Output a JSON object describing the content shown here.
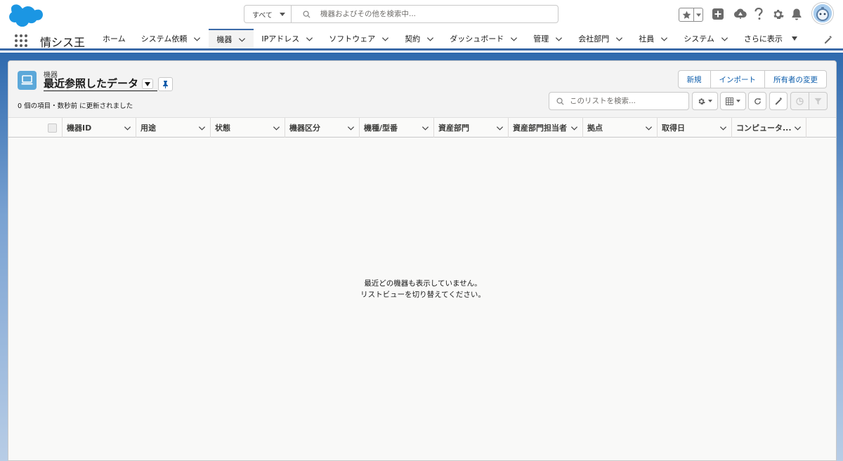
{
  "global": {
    "search_scope": "すべて",
    "search_placeholder": "機器およびその他を検索中..."
  },
  "nav": {
    "app_name": "情シス王",
    "items": [
      {
        "label": "ホーム",
        "chevron": false
      },
      {
        "label": "システム依頼",
        "chevron": true
      },
      {
        "label": "機器",
        "chevron": true,
        "active": true
      },
      {
        "label": "IPアドレス",
        "chevron": true
      },
      {
        "label": "ソフトウェア",
        "chevron": true
      },
      {
        "label": "契約",
        "chevron": true
      },
      {
        "label": "ダッシュボード",
        "chevron": true
      },
      {
        "label": "管理",
        "chevron": true
      },
      {
        "label": "会社部門",
        "chevron": true
      },
      {
        "label": "社員",
        "chevron": true
      },
      {
        "label": "システム",
        "chevron": true
      }
    ],
    "more_label": "さらに表示"
  },
  "list_view": {
    "object_label": "機器",
    "view_name": "最近参照したデータ",
    "meta": "0 個の項目・数秒前 に更新されました",
    "buttons": {
      "new": "新規",
      "import": "インポート",
      "change_owner": "所有者の変更"
    },
    "search_placeholder": "このリストを検索...",
    "columns": [
      "機器ID",
      "用途",
      "状態",
      "機器区分",
      "機種/型番",
      "資産部門",
      "資産部門担当者",
      "拠点",
      "取得日",
      "コンピュータ..."
    ],
    "empty_line1": "最近どの機器も表示していません。",
    "empty_line2": "リストビューを切り替えてください。"
  }
}
